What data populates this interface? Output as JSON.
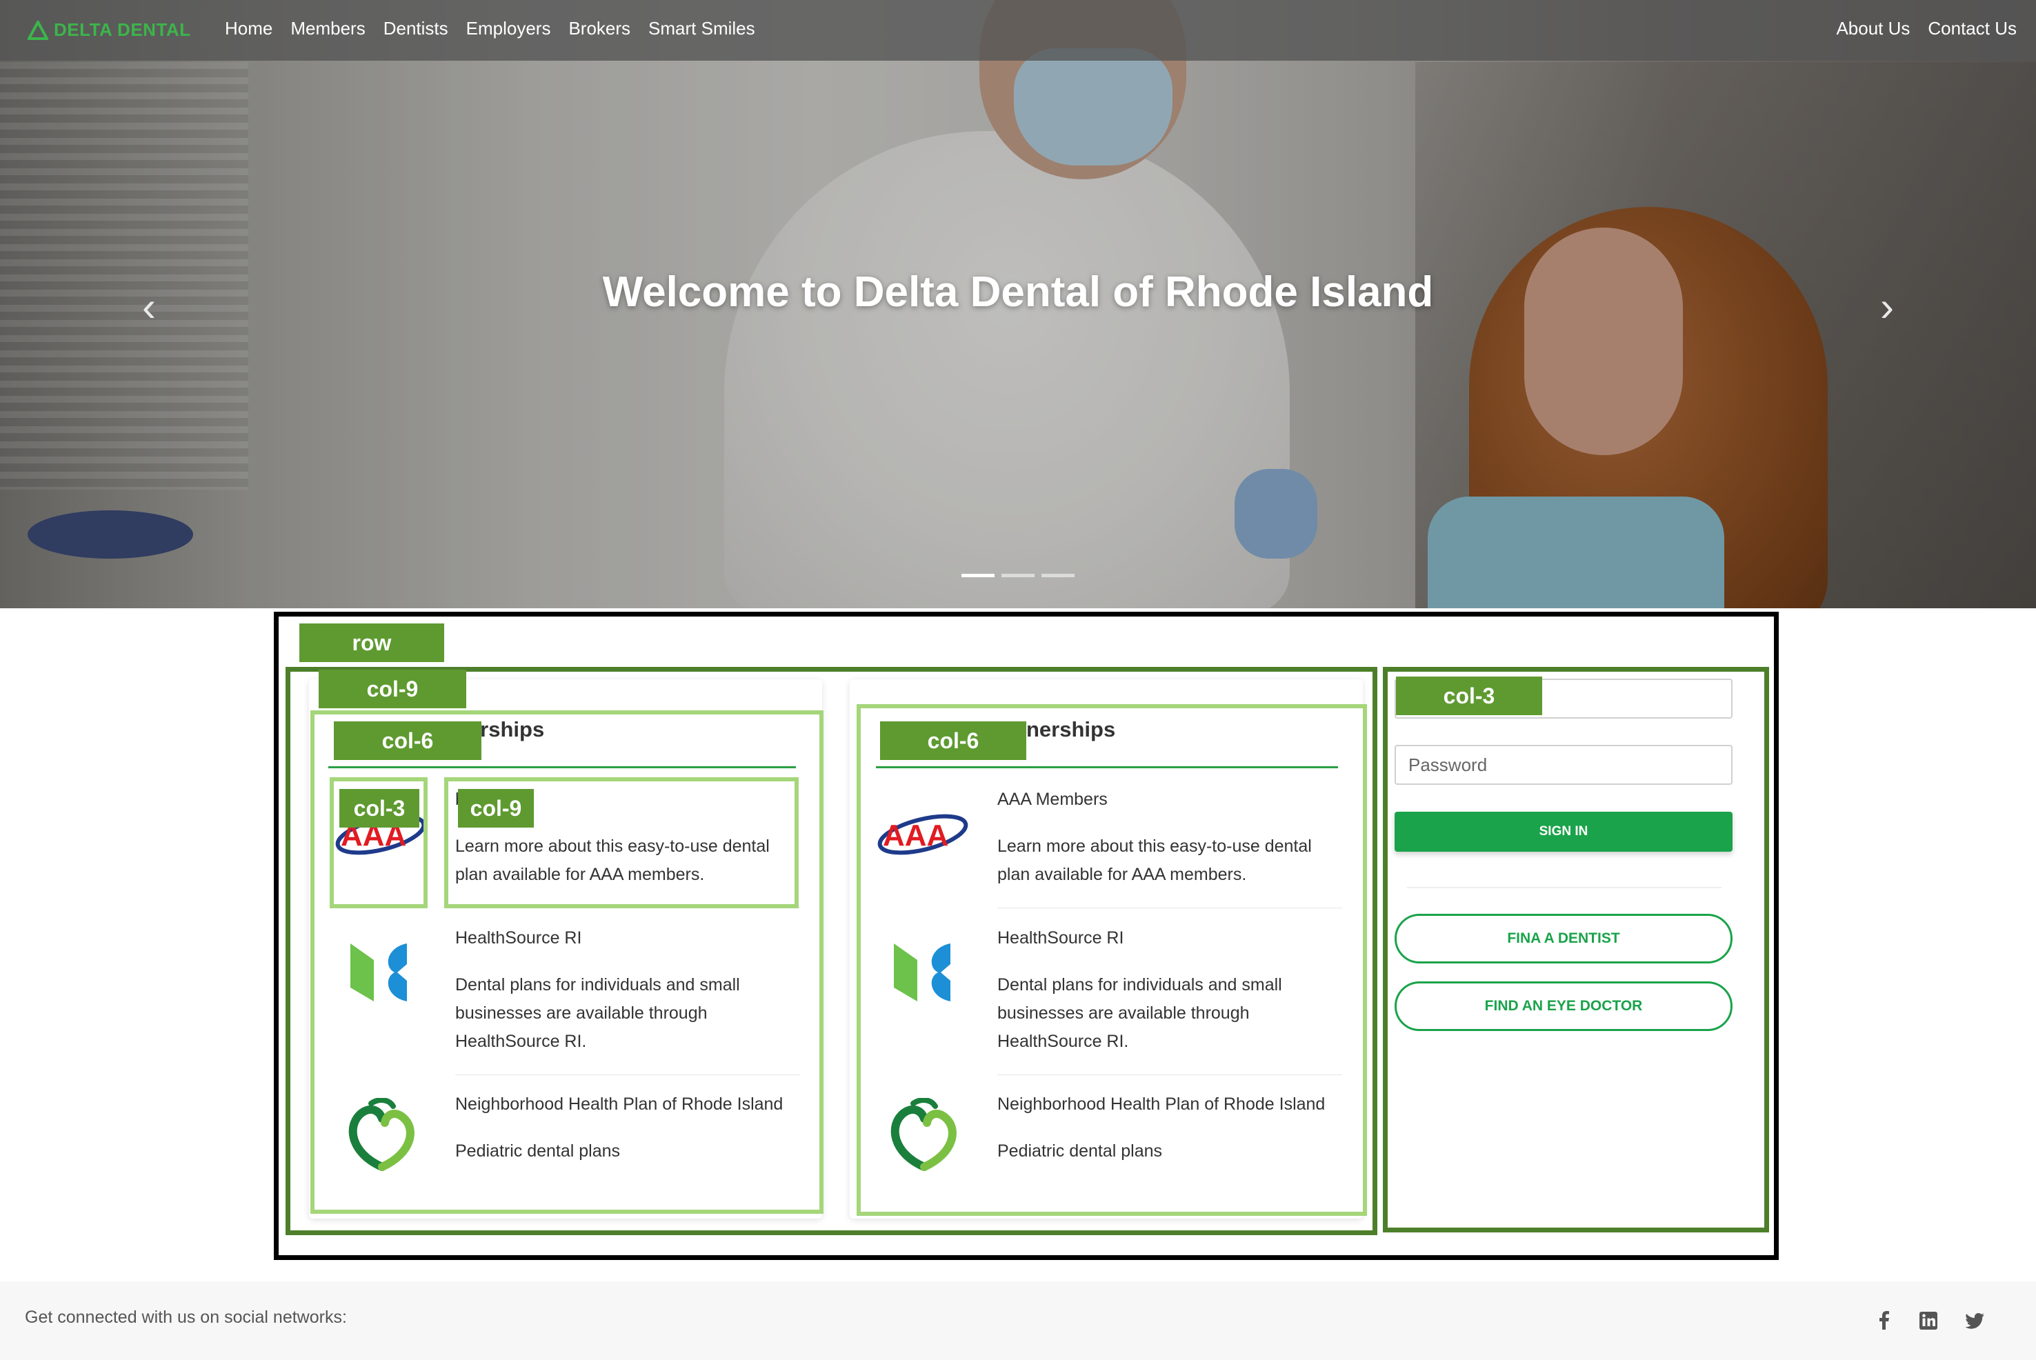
{
  "nav": {
    "brand": "DELTA DENTAL",
    "left_links": [
      "Home",
      "Members",
      "Dentists",
      "Employers",
      "Brokers",
      "Smart Smiles"
    ],
    "right_links": [
      "About Us",
      "Contact Us"
    ]
  },
  "hero": {
    "title": "Welcome to Delta Dental of Rhode Island",
    "prev_arrow": "‹",
    "next_arrow": "›",
    "slide_count": 3,
    "active_slide": 1
  },
  "grid_labels": {
    "row": "row",
    "col9": "col-9",
    "col6_left": "col-6",
    "col6_right": "col-6",
    "col3_inner": "col-3",
    "col9_inner": "col-9",
    "col3_outer": "col-3"
  },
  "partnerships": [
    {
      "title_visible": "nerships",
      "items": [
        {
          "logo": "aaa-logo",
          "name": "bers",
          "description_lines": [
            "Learn more about this easy-to-use dental",
            "plan available for AAA members."
          ]
        },
        {
          "logo": "healthsource-logo",
          "name": "HealthSource RI",
          "description_lines": [
            "Dental plans for individuals and small",
            "businesses are available through",
            "HealthSource RI."
          ]
        },
        {
          "logo": "nhp-logo",
          "name": "Neighborhood Health Plan of Rhode Island",
          "description_lines": [
            "Pediatric dental plans"
          ]
        }
      ]
    },
    {
      "title_visible": "nerships",
      "items": [
        {
          "logo": "aaa-logo",
          "name": "AAA Members",
          "description_lines": [
            "Learn more about this easy-to-use dental",
            "plan available for AAA members."
          ]
        },
        {
          "logo": "healthsource-logo",
          "name": "HealthSource RI",
          "description_lines": [
            "Dental plans for individuals and small",
            "businesses are available through",
            "HealthSource RI."
          ]
        },
        {
          "logo": "nhp-logo",
          "name": "Neighborhood Health Plan of Rhode Island",
          "description_lines": [
            "Pediatric dental plans"
          ]
        }
      ]
    }
  ],
  "signin": {
    "username_placeholder": "",
    "password_placeholder": "Password",
    "signin_label": "SIGN IN",
    "find_dentist_label": "FINA A DENTIST",
    "find_eye_doctor_label": "FIND AN EYE DOCTOR"
  },
  "footer": {
    "text": "Get connected with us on social networks:",
    "social_icons": [
      "facebook-icon",
      "linkedin-icon",
      "twitter-icon"
    ]
  },
  "colors": {
    "brand_green": "#1aa34a",
    "grid_dark_green": "#4d7f2b",
    "grid_light_green": "#a5d67a",
    "label_green": "#5e9a30"
  }
}
